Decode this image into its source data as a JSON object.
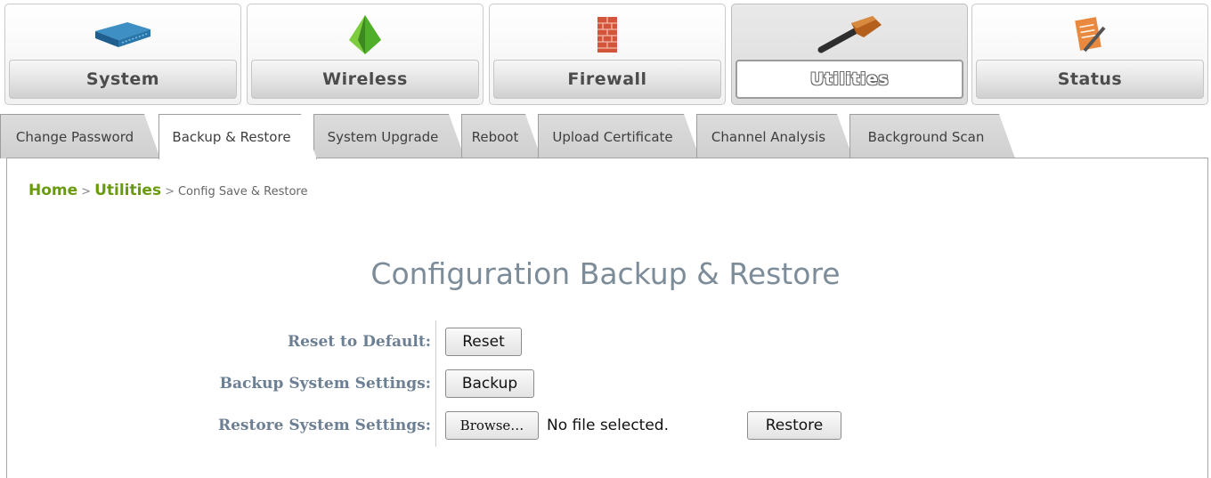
{
  "main_nav": [
    {
      "label": "System",
      "icon": "network-switch-icon"
    },
    {
      "label": "Wireless",
      "icon": "wireless-gem-icon"
    },
    {
      "label": "Firewall",
      "icon": "brick-wall-icon"
    },
    {
      "label": "Utilities",
      "icon": "hammer-icon",
      "active": true
    },
    {
      "label": "Status",
      "icon": "clipboard-pencil-icon"
    }
  ],
  "sub_tabs": [
    {
      "label": "Change Password"
    },
    {
      "label": "Backup & Restore",
      "active": true
    },
    {
      "label": "System Upgrade"
    },
    {
      "label": "Reboot"
    },
    {
      "label": "Upload Certificate"
    },
    {
      "label": "Channel Analysis"
    },
    {
      "label": "Background Scan"
    }
  ],
  "breadcrumb": {
    "home": "Home",
    "section": "Utilities",
    "current": "Config Save & Restore",
    "separator": ">"
  },
  "page_title": "Configuration Backup & Restore",
  "form": {
    "reset": {
      "label": "Reset to Default:",
      "button": "Reset"
    },
    "backup": {
      "label": "Backup System Settings:",
      "button": "Backup"
    },
    "restore": {
      "label": "Restore System Settings:",
      "browse": "Browse…",
      "file_status": "No file selected.",
      "button": "Restore"
    }
  },
  "colors": {
    "link_green": "#6a9a0e",
    "label_blue": "#6c7f93",
    "title": "#7d8c99"
  }
}
